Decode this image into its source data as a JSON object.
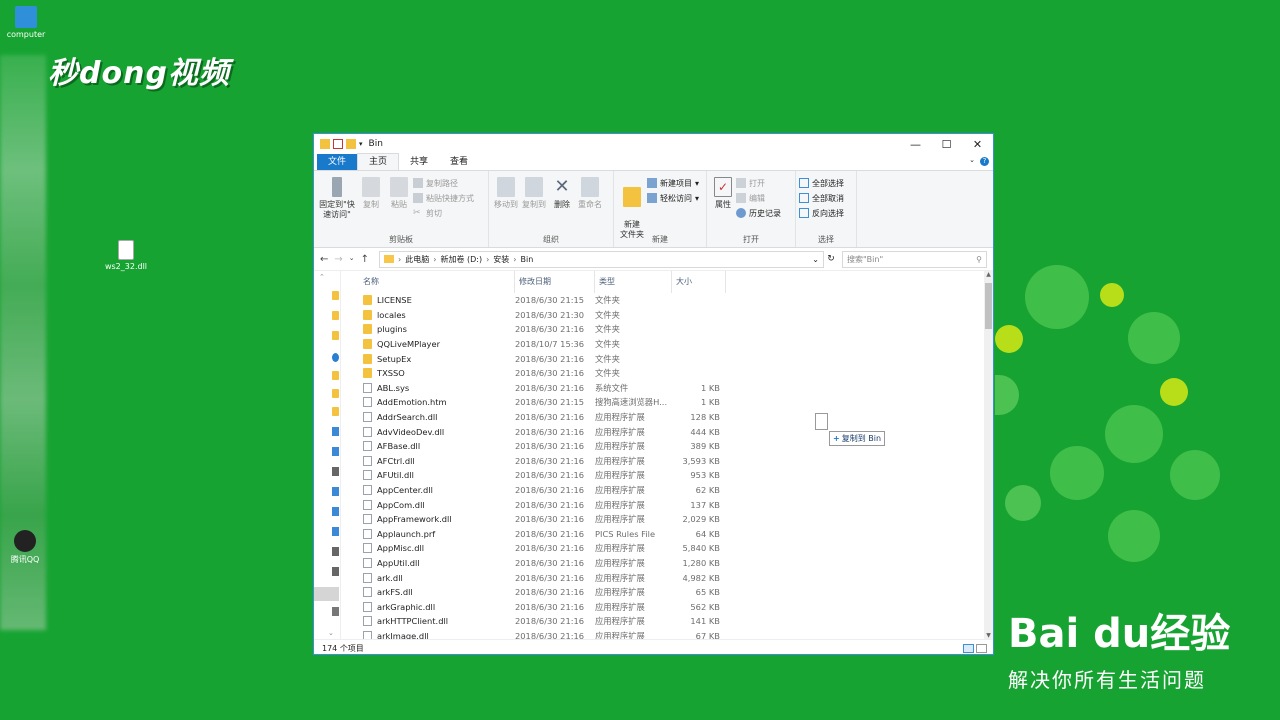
{
  "desktop": {
    "icons": [
      {
        "name": "computer-desktop-icon",
        "label": "computer"
      },
      {
        "name": "dll-file-desktop-icon",
        "label": "ws2_32.dll"
      },
      {
        "name": "qq-desktop-icon",
        "label": "腾讯QQ"
      }
    ],
    "watermark_left": "秒dong视频",
    "baidu_brand": "Bai du经验",
    "baidu_slogan": "解决你所有生活问题"
  },
  "window": {
    "title": "Bin",
    "controls": [
      "—",
      "☐",
      "✕"
    ],
    "tabs": [
      "文件",
      "主页",
      "共享",
      "查看"
    ],
    "active_tab": "主页",
    "ribbon": {
      "clipboard": {
        "name": "剪贴板",
        "pin": "固定到\"快速访问\"",
        "copy": "复制",
        "paste": "粘贴",
        "copy_path": "复制路径",
        "paste_shortcut": "粘贴快捷方式",
        "cut": "剪切"
      },
      "organize": {
        "name": "组织",
        "move_to": "移动到",
        "copy_to": "复制到",
        "delete": "删除",
        "rename": "重命名"
      },
      "new": {
        "name": "新建",
        "new_folder": "新建\n文件夹",
        "new_item": "新建项目",
        "easy_access": "轻松访问"
      },
      "open": {
        "name": "打开",
        "properties": "属性",
        "open": "打开",
        "edit": "编辑",
        "history": "历史记录"
      },
      "select": {
        "name": "选择",
        "select_all": "全部选择",
        "select_none": "全部取消",
        "invert": "反向选择"
      }
    },
    "address": {
      "crumbs": [
        "此电脑",
        "新加卷 (D:)",
        "安装",
        "Bin"
      ],
      "search_placeholder": "搜索\"Bin\""
    },
    "columns": [
      "名称",
      "修改日期",
      "类型",
      "大小"
    ],
    "files": [
      {
        "name": "LICENSE",
        "date": "2018/6/30 21:15",
        "type": "文件夹",
        "size": "",
        "kind": "folder"
      },
      {
        "name": "locales",
        "date": "2018/6/30 21:30",
        "type": "文件夹",
        "size": "",
        "kind": "folder"
      },
      {
        "name": "plugins",
        "date": "2018/6/30 21:16",
        "type": "文件夹",
        "size": "",
        "kind": "folder"
      },
      {
        "name": "QQLiveMPlayer",
        "date": "2018/10/7 15:36",
        "type": "文件夹",
        "size": "",
        "kind": "folder"
      },
      {
        "name": "SetupEx",
        "date": "2018/6/30 21:16",
        "type": "文件夹",
        "size": "",
        "kind": "folder"
      },
      {
        "name": "TXSSO",
        "date": "2018/6/30 21:16",
        "type": "文件夹",
        "size": "",
        "kind": "folder"
      },
      {
        "name": "ABL.sys",
        "date": "2018/6/30 21:16",
        "type": "系统文件",
        "size": "1 KB",
        "kind": "file"
      },
      {
        "name": "AddEmotion.htm",
        "date": "2018/6/30 21:15",
        "type": "搜狗高速浏览器H...",
        "size": "1 KB",
        "kind": "file"
      },
      {
        "name": "AddrSearch.dll",
        "date": "2018/6/30 21:16",
        "type": "应用程序扩展",
        "size": "128 KB",
        "kind": "file"
      },
      {
        "name": "AdvVideoDev.dll",
        "date": "2018/6/30 21:16",
        "type": "应用程序扩展",
        "size": "444 KB",
        "kind": "file"
      },
      {
        "name": "AFBase.dll",
        "date": "2018/6/30 21:16",
        "type": "应用程序扩展",
        "size": "389 KB",
        "kind": "file"
      },
      {
        "name": "AFCtrl.dll",
        "date": "2018/6/30 21:16",
        "type": "应用程序扩展",
        "size": "3,593 KB",
        "kind": "file"
      },
      {
        "name": "AFUtil.dll",
        "date": "2018/6/30 21:16",
        "type": "应用程序扩展",
        "size": "953 KB",
        "kind": "file"
      },
      {
        "name": "AppCenter.dll",
        "date": "2018/6/30 21:16",
        "type": "应用程序扩展",
        "size": "62 KB",
        "kind": "file"
      },
      {
        "name": "AppCom.dll",
        "date": "2018/6/30 21:16",
        "type": "应用程序扩展",
        "size": "137 KB",
        "kind": "file"
      },
      {
        "name": "AppFramework.dll",
        "date": "2018/6/30 21:16",
        "type": "应用程序扩展",
        "size": "2,029 KB",
        "kind": "file"
      },
      {
        "name": "Applaunch.prf",
        "date": "2018/6/30 21:16",
        "type": "PICS Rules File",
        "size": "64 KB",
        "kind": "file"
      },
      {
        "name": "AppMisc.dll",
        "date": "2018/6/30 21:16",
        "type": "应用程序扩展",
        "size": "5,840 KB",
        "kind": "file"
      },
      {
        "name": "AppUtil.dll",
        "date": "2018/6/30 21:16",
        "type": "应用程序扩展",
        "size": "1,280 KB",
        "kind": "file"
      },
      {
        "name": "ark.dll",
        "date": "2018/6/30 21:16",
        "type": "应用程序扩展",
        "size": "4,982 KB",
        "kind": "file"
      },
      {
        "name": "arkFS.dll",
        "date": "2018/6/30 21:16",
        "type": "应用程序扩展",
        "size": "65 KB",
        "kind": "file"
      },
      {
        "name": "arkGraphic.dll",
        "date": "2018/6/30 21:16",
        "type": "应用程序扩展",
        "size": "562 KB",
        "kind": "file"
      },
      {
        "name": "arkHTTPClient.dll",
        "date": "2018/6/30 21:16",
        "type": "应用程序扩展",
        "size": "141 KB",
        "kind": "file"
      },
      {
        "name": "arkImage.dll",
        "date": "2018/6/30 21:16",
        "type": "应用程序扩展",
        "size": "67 KB",
        "kind": "file"
      }
    ],
    "status": "174 个项目",
    "drag_tooltip": "复制到 Bin"
  },
  "colors": {
    "desktop": "#17a332",
    "accent": "#1979ca",
    "folder": "#f3c33f"
  }
}
